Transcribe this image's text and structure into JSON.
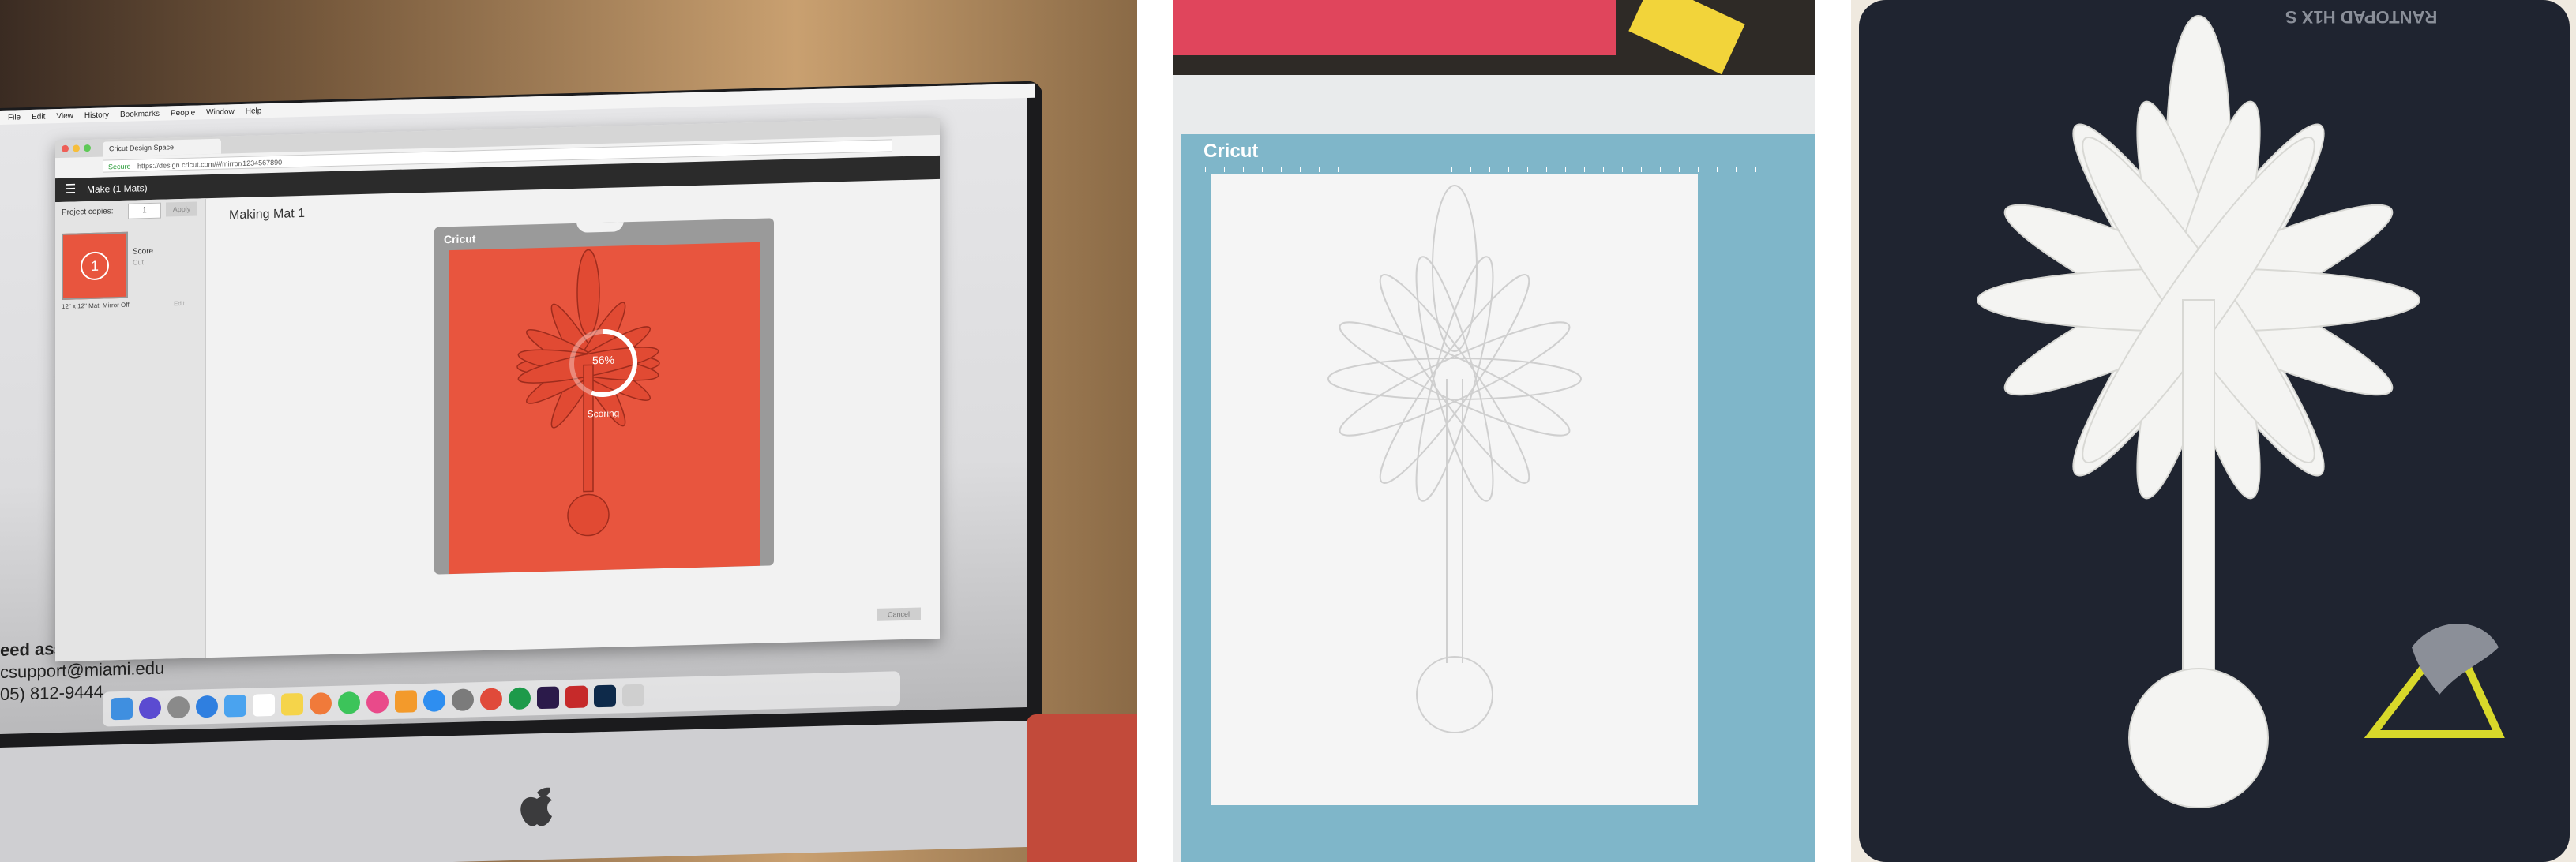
{
  "photo1": {
    "browser_tab": "Cricut Design Space",
    "url": "https://design.cricut.com/#/mirror/1234567890",
    "secure_label": "Secure",
    "window_title": "Make (1 Mats)",
    "project_copies_label": "Project copies:",
    "project_copies_value": "1",
    "apply_label": "Apply",
    "mat_label": "Making Mat 1",
    "mat_number": "1",
    "mat_status_title": "Score",
    "mat_status_sub": "Cut",
    "mat_size_label": "12\" x 12\" Mat, Mirror Off",
    "edit_label": "Edit",
    "cricut_logo": "Cricut",
    "progress_percent": "56%",
    "progress_fraction": 0.56,
    "progress_status": "Scoring",
    "cancel_label": "Cancel",
    "support_line1": "eed assis",
    "support_line2": "csupport@miami.edu",
    "support_line3": "05) 812-9444",
    "menubar_items": [
      "File",
      "Edit",
      "View",
      "History",
      "Bookmarks",
      "People",
      "Window",
      "Help"
    ],
    "accent_color": "#e8553e"
  },
  "photo2": {
    "mat_brand": "Cricut",
    "mat_color": "#7fb6c9"
  },
  "photo3": {
    "mat_brand": "RANTOPAD H1X S",
    "logo_color": "#d8d82a"
  }
}
